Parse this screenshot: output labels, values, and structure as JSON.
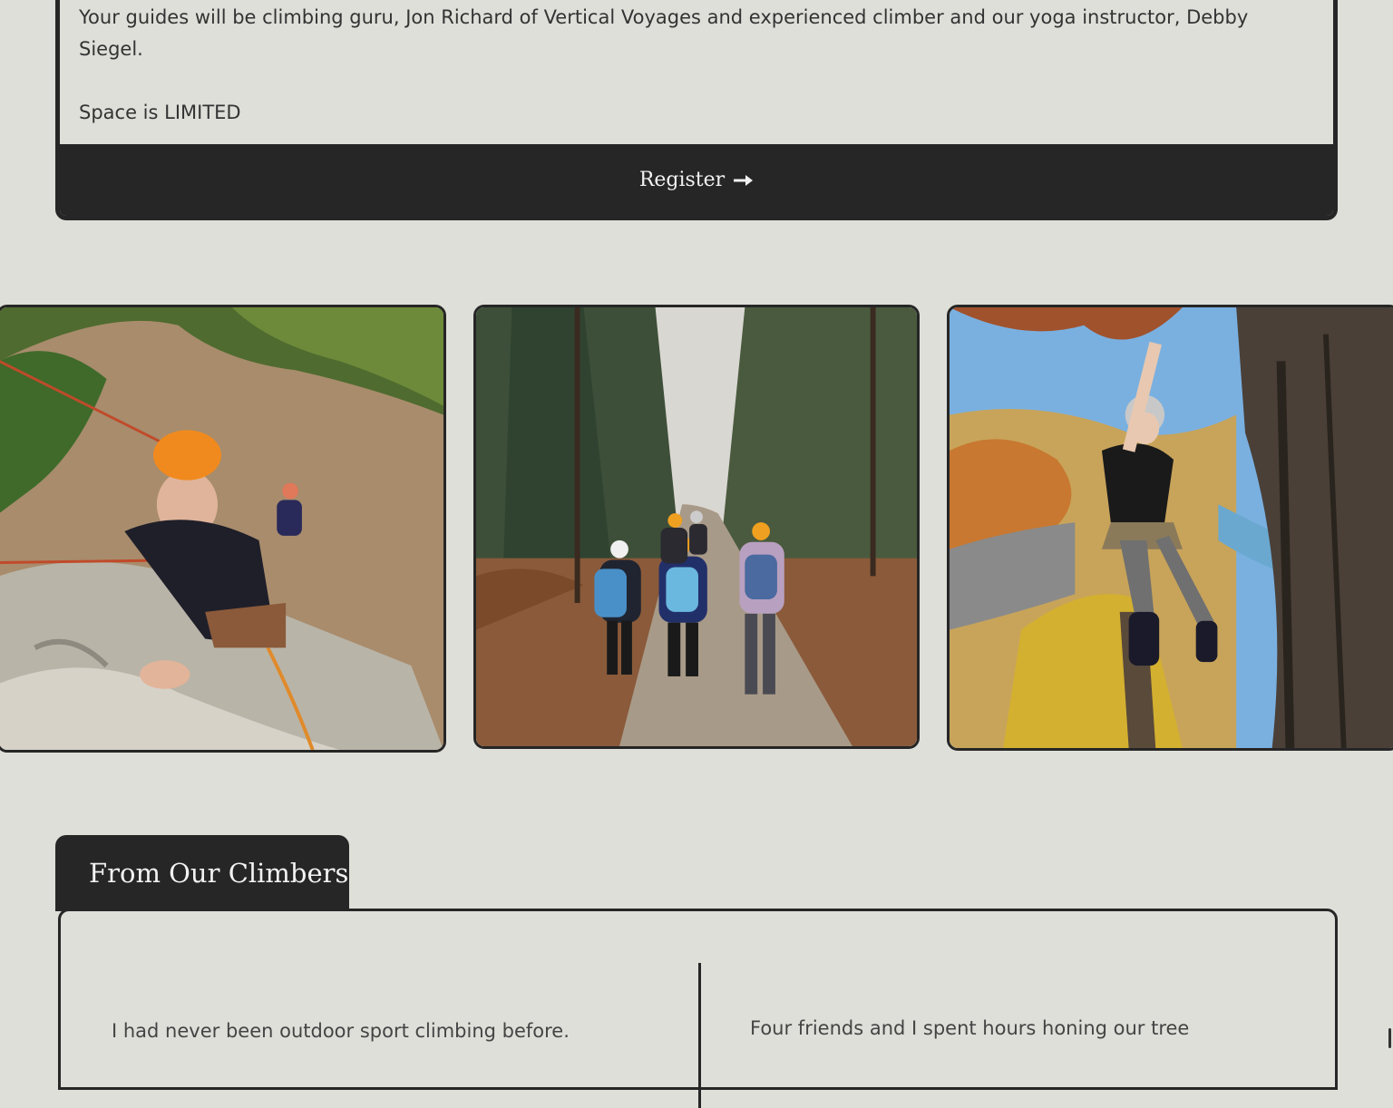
{
  "event": {
    "description": "Your guides will be climbing guru, Jon Richard of Vertical Voyages and experienced climber and our yoga instructor, Debby Siegel.",
    "notice": "Space is LIMITED",
    "register_label": "Register"
  },
  "gallery": [
    {
      "alt": "Climber in orange helmet on rock face"
    },
    {
      "alt": "Group hiking on leafy forest trail"
    },
    {
      "alt": "Climber in tree above autumn landscape"
    }
  ],
  "testimonials": {
    "heading": "From Our Climbers",
    "quotes": [
      "I had never been outdoor sport climbing before.",
      "Four friends and I spent hours honing our tree"
    ]
  },
  "colors": {
    "background": "#dfdfda",
    "dark": "#262626"
  }
}
